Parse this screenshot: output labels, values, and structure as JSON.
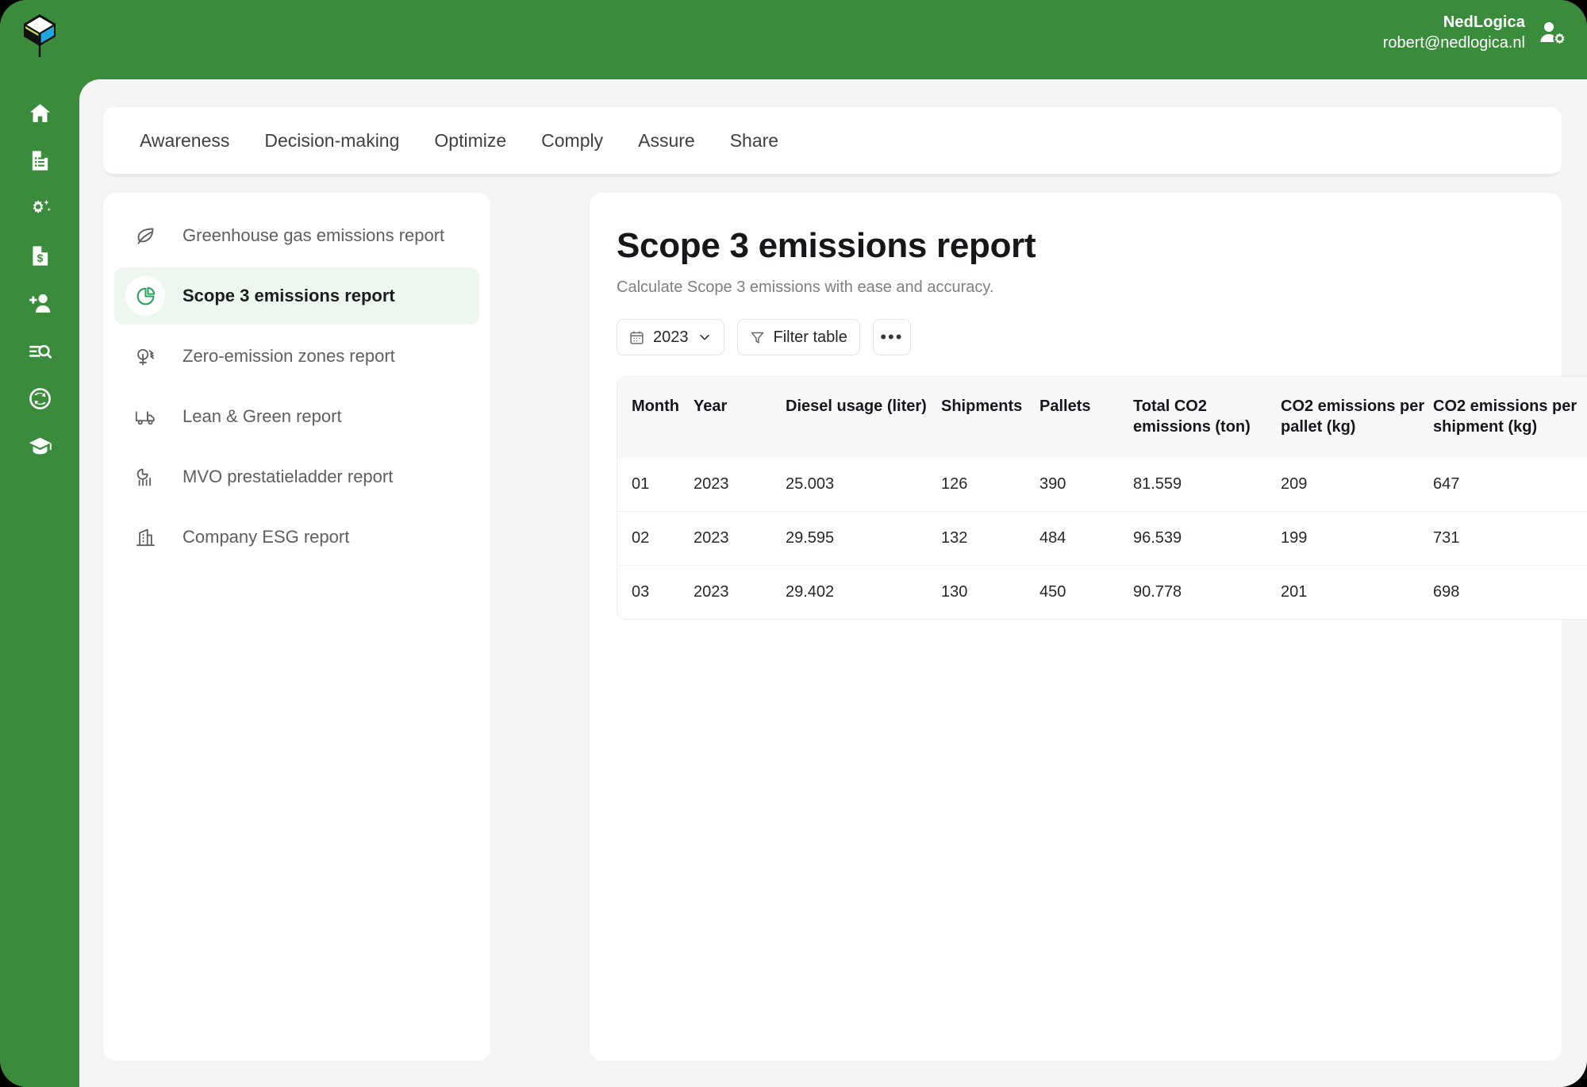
{
  "brand": {
    "logo_icon": "cube-logo-icon",
    "green": "#3b8b3d",
    "accent_green": "#22a45d"
  },
  "header": {
    "org_name": "NedLogica",
    "user_email": "robert@nedlogica.nl",
    "avatar_icon": "user-settings-icon"
  },
  "rail": {
    "items": [
      {
        "icon": "home-icon",
        "name": "home"
      },
      {
        "icon": "file-list-icon",
        "name": "documents"
      },
      {
        "icon": "gear-sparkle-icon",
        "name": "settings-ai"
      },
      {
        "icon": "invoice-dollar-icon",
        "name": "finance"
      },
      {
        "icon": "user-add-icon",
        "name": "add-user"
      },
      {
        "icon": "list-search-icon",
        "name": "search-records"
      },
      {
        "icon": "recycle-circle-icon",
        "name": "sustainability"
      },
      {
        "icon": "graduation-cap-icon",
        "name": "academy"
      }
    ]
  },
  "nav": {
    "tabs": [
      {
        "label": "Awareness"
      },
      {
        "label": "Decision-making"
      },
      {
        "label": "Optimize"
      },
      {
        "label": "Comply"
      },
      {
        "label": "Assure"
      },
      {
        "label": "Share"
      }
    ]
  },
  "reports": {
    "items": [
      {
        "label": "Greenhouse gas emissions report",
        "icon": "leaf-icon",
        "selected": false
      },
      {
        "label": "Scope 3 emissions report",
        "icon": "pie-chart-icon",
        "selected": true
      },
      {
        "label": "Zero-emission zones report",
        "icon": "tree-signal-icon",
        "selected": false
      },
      {
        "label": "Lean & Green report",
        "icon": "truck-icon",
        "selected": false
      },
      {
        "label": "MVO prestatieladder report",
        "icon": "pie-bars-icon",
        "selected": false
      },
      {
        "label": "Company ESG report",
        "icon": "building-icon",
        "selected": false
      }
    ]
  },
  "main": {
    "title": "Scope 3 emissions report",
    "subtitle": "Calculate Scope 3 emissions with ease and accuracy.",
    "toolbar": {
      "year_value": "2023",
      "year_icon": "calendar-icon",
      "year_chevron_icon": "chevron-down-icon",
      "filter_label": "Filter table",
      "filter_icon": "funnel-icon",
      "more_label": "•••",
      "more_icon": "ellipsis-icon"
    },
    "table": {
      "columns": [
        "Month",
        "Year",
        "Diesel usage (liter)",
        "Shipments",
        "Pallets",
        "Total CO2 emissions (ton)",
        "CO2 emissions per pallet (kg)",
        "CO2 emissions per shipment (kg)"
      ],
      "rows": [
        {
          "month": "01",
          "year": "2023",
          "diesel_usage_liter": "25.003",
          "shipments": "126",
          "pallets": "390",
          "total_co2_ton": "81.559",
          "co2_per_pallet_kg": "209",
          "co2_per_shipment_kg": "647"
        },
        {
          "month": "02",
          "year": "2023",
          "diesel_usage_liter": "29.595",
          "shipments": "132",
          "pallets": "484",
          "total_co2_ton": "96.539",
          "co2_per_pallet_kg": "199",
          "co2_per_shipment_kg": "731"
        },
        {
          "month": "03",
          "year": "2023",
          "diesel_usage_liter": "29.402",
          "shipments": "130",
          "pallets": "450",
          "total_co2_ton": "90.778",
          "co2_per_pallet_kg": "201",
          "co2_per_shipment_kg": "698"
        }
      ]
    }
  }
}
